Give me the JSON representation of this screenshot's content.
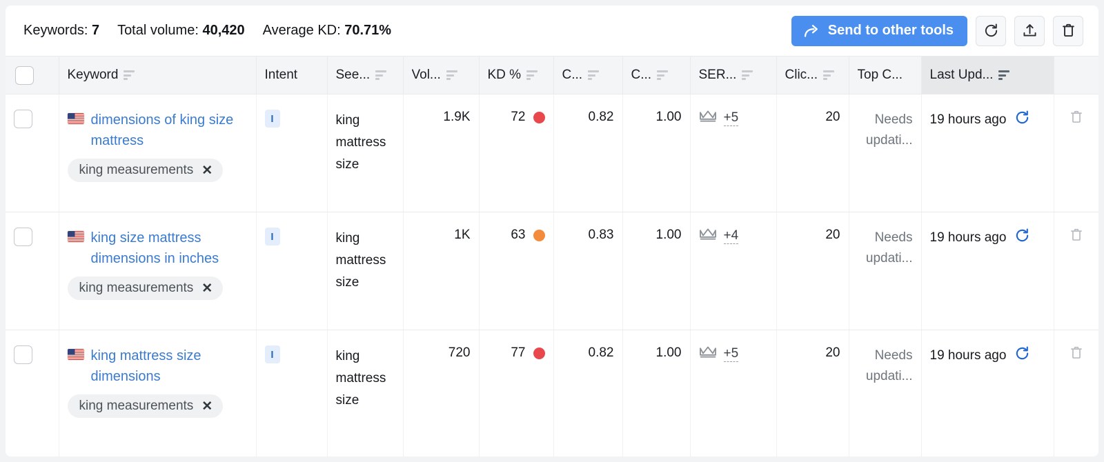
{
  "summary": {
    "keywords_label": "Keywords:",
    "keywords_value": "7",
    "volume_label": "Total volume:",
    "volume_value": "40,420",
    "kd_label": "Average KD:",
    "kd_value": "70.71%"
  },
  "toolbar": {
    "send_label": "Send to other tools",
    "send_icon": "share-arrow-icon",
    "refresh_icon": "refresh-icon",
    "export_icon": "export-upload-icon",
    "delete_icon": "trash-icon",
    "primary_color": "#4a8ff0"
  },
  "table": {
    "columns": [
      {
        "key": "select",
        "label": "",
        "sortable": false,
        "align": "left"
      },
      {
        "key": "keyword",
        "label": "Keyword",
        "sortable": true,
        "align": "left"
      },
      {
        "key": "intent",
        "label": "Intent",
        "sortable": false,
        "align": "left"
      },
      {
        "key": "seed",
        "label": "See...",
        "sortable": true,
        "align": "left"
      },
      {
        "key": "volume",
        "label": "Vol...",
        "sortable": true,
        "align": "right"
      },
      {
        "key": "kd",
        "label": "KD %",
        "sortable": true,
        "align": "right"
      },
      {
        "key": "cpc",
        "label": "C...",
        "sortable": true,
        "align": "right"
      },
      {
        "key": "com",
        "label": "C...",
        "sortable": true,
        "align": "right"
      },
      {
        "key": "serp",
        "label": "SER...",
        "sortable": true,
        "align": "left"
      },
      {
        "key": "clicks",
        "label": "Clic...",
        "sortable": true,
        "align": "right"
      },
      {
        "key": "topc",
        "label": "Top C...",
        "sortable": false,
        "align": "right"
      },
      {
        "key": "updated",
        "label": "Last Upd...",
        "sortable": true,
        "align": "left",
        "sorted": true
      },
      {
        "key": "actions",
        "label": "",
        "sortable": false,
        "align": "center"
      }
    ],
    "rows": [
      {
        "selected": false,
        "country_icon": "us-flag-icon",
        "keyword": "dimensions of king size mattress",
        "tag": "king measurements",
        "tag_remove_icon": "close-icon",
        "intent": "I",
        "seed": "king mattress size",
        "volume": "1.9K",
        "kd": "72",
        "kd_color": "#e8474c",
        "cpc": "0.82",
        "com": "1.00",
        "serp_icon": "crown-icon",
        "serp_more": "+5",
        "clicks": "20",
        "top_competitor": "Needs updati...",
        "updated": "19 hours ago",
        "refresh_icon": "refresh-icon",
        "delete_icon": "trash-icon"
      },
      {
        "selected": false,
        "country_icon": "us-flag-icon",
        "keyword": "king size mattress dimensions in inches",
        "tag": "king measurements",
        "tag_remove_icon": "close-icon",
        "intent": "I",
        "seed": "king mattress size",
        "volume": "1K",
        "kd": "63",
        "kd_color": "#f28c3c",
        "cpc": "0.83",
        "com": "1.00",
        "serp_icon": "crown-icon",
        "serp_more": "+4",
        "clicks": "20",
        "top_competitor": "Needs updati...",
        "updated": "19 hours ago",
        "refresh_icon": "refresh-icon",
        "delete_icon": "trash-icon"
      },
      {
        "selected": false,
        "country_icon": "us-flag-icon",
        "keyword": "king mattress size dimensions",
        "tag": "king measurements",
        "tag_remove_icon": "close-icon",
        "intent": "I",
        "seed": "king mattress size",
        "volume": "720",
        "kd": "77",
        "kd_color": "#e8474c",
        "cpc": "0.82",
        "com": "1.00",
        "serp_icon": "crown-icon",
        "serp_more": "+5",
        "clicks": "20",
        "top_competitor": "Needs updati...",
        "updated": "19 hours ago",
        "refresh_icon": "refresh-icon",
        "delete_icon": "trash-icon"
      }
    ]
  }
}
